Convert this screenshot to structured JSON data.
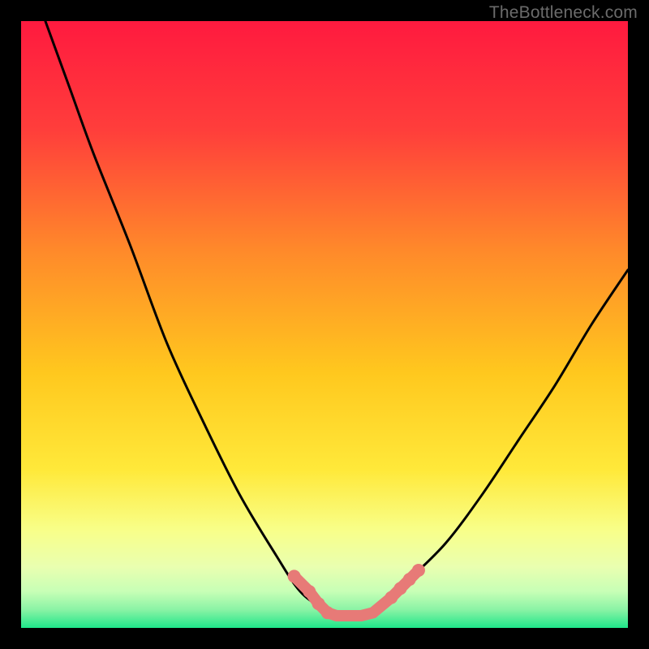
{
  "watermark": "TheBottleneck.com",
  "colors": {
    "frame": "#000000",
    "gradient_top": "#ff1a3f",
    "gradient_mid_upper": "#ff6a36",
    "gradient_mid": "#ffd21e",
    "gradient_lower": "#f8ff8a",
    "gradient_lower2": "#d4ffb0",
    "gradient_bottom": "#1fe68a",
    "curve": "#000000",
    "marker": "#e77a77"
  },
  "chart_data": {
    "type": "line",
    "title": "",
    "xlabel": "",
    "ylabel": "",
    "xlim": [
      0,
      100
    ],
    "ylim": [
      0,
      100
    ],
    "grid": false,
    "series": [
      {
        "name": "bottleneck-curve",
        "x": [
          4,
          8,
          12,
          18,
          24,
          30,
          36,
          42,
          46,
          50,
          52,
          54,
          56,
          58,
          60,
          64,
          70,
          76,
          82,
          88,
          94,
          100
        ],
        "y": [
          100,
          89,
          78,
          63,
          47,
          34,
          22,
          12,
          6,
          3,
          2,
          2,
          2,
          3,
          4,
          8,
          14,
          22,
          31,
          40,
          50,
          59
        ]
      }
    ],
    "markers": [
      {
        "x": 45.0,
        "y": 8.5
      },
      {
        "x": 47.5,
        "y": 6.0
      },
      {
        "x": 49.0,
        "y": 4.0
      },
      {
        "x": 50.5,
        "y": 2.5
      },
      {
        "x": 52.0,
        "y": 2.0
      },
      {
        "x": 54.0,
        "y": 2.0
      },
      {
        "x": 56.0,
        "y": 2.0
      },
      {
        "x": 58.0,
        "y": 2.5
      },
      {
        "x": 61.0,
        "y": 5.0
      },
      {
        "x": 62.5,
        "y": 6.5
      },
      {
        "x": 64.0,
        "y": 8.0
      },
      {
        "x": 65.5,
        "y": 9.5
      }
    ]
  }
}
